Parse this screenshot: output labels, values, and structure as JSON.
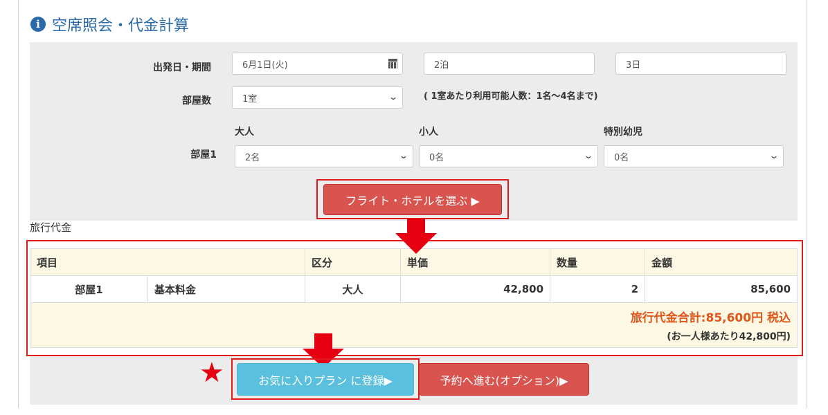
{
  "section": {
    "icon": "info-icon",
    "title": "空席照会・代金計算"
  },
  "form": {
    "departure_label": "出発日・期間",
    "date_value": "6月1日(火)",
    "nights_value": "2泊",
    "days_value": "3日",
    "rooms_label": "部屋数",
    "rooms_value": "1室",
    "rooms_note": "( 1室あたり利用可能人数：1名～4名まで)",
    "adult_label": "大人",
    "child_label": "小人",
    "infant_label": "特別幼児",
    "room1_label": "部屋1",
    "adult_value": "2名",
    "child_value": "0名",
    "infant_value": "0名",
    "select_button": "フライト・ホテルを選ぶ ▶"
  },
  "price": {
    "heading": "旅行代金",
    "headers": [
      "項目",
      "区分",
      "単価",
      "数量",
      "金額"
    ],
    "rows": [
      {
        "room": "部屋1",
        "item": "基本料金",
        "category": "大人",
        "unit_price": "42,800",
        "quantity": "2",
        "amount": "85,600"
      }
    ],
    "total": "旅行代金合計:85,600円 税込",
    "per_person": "(お一人様あたり42,800円)"
  },
  "actions": {
    "favorite_button": "お気に入りプラン に登録▶",
    "reserve_button": "予約へ進む(オプション)▶"
  },
  "annotations": {
    "star": "★"
  },
  "colors": {
    "accent_blue": "#2a6aa8",
    "button_red": "#d9534f",
    "button_blue": "#5bc0de",
    "highlight_red": "#e01b1b",
    "total_orange": "#e0561b"
  }
}
